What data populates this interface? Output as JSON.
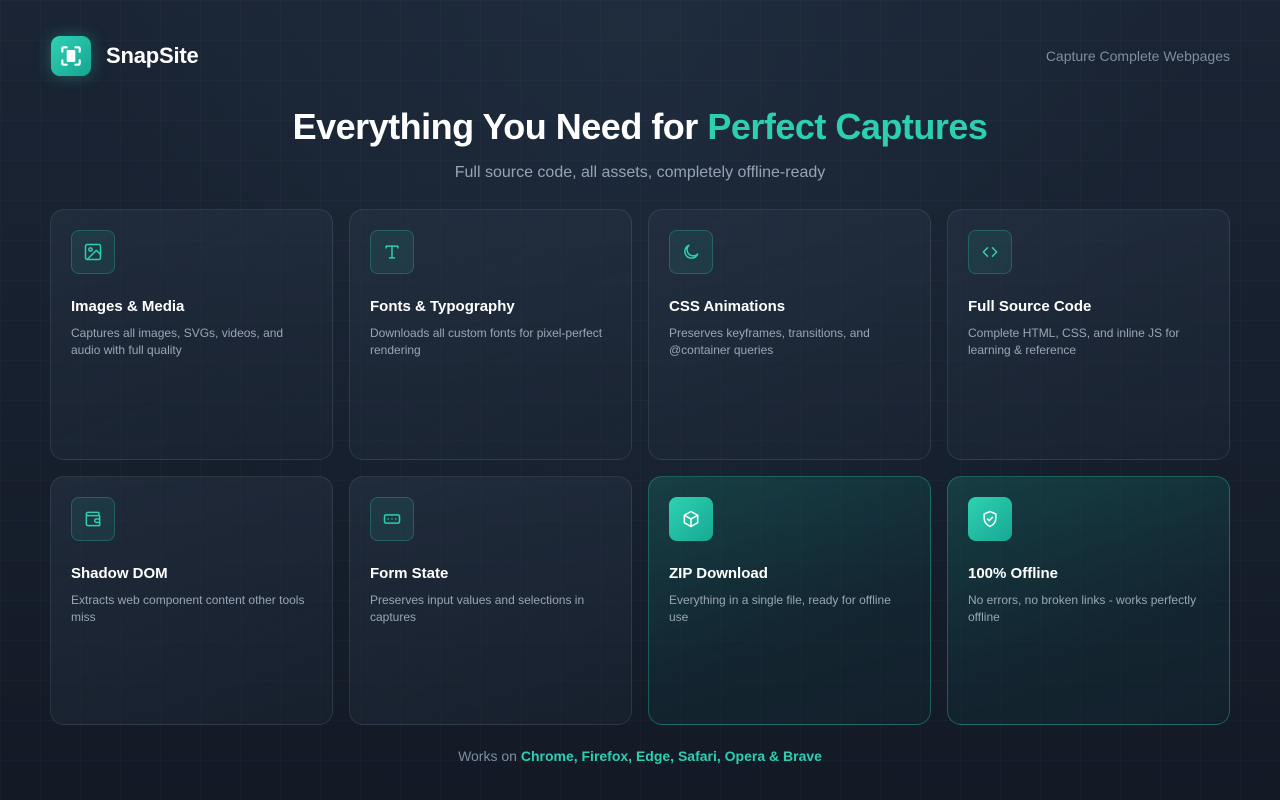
{
  "brand": {
    "name": "SnapSite",
    "tagline": "Capture Complete Webpages"
  },
  "hero": {
    "title_main": "Everything You Need for ",
    "title_accent": "Perfect Captures",
    "subtitle": "Full source code, all assets, completely offline-ready"
  },
  "features": [
    {
      "title": "Images & Media",
      "description": "Captures all images, SVGs, videos, and audio with full quality",
      "icon": "image-icon"
    },
    {
      "title": "Fonts & Typography",
      "description": "Downloads all custom fonts for pixel-perfect rendering",
      "icon": "type-icon"
    },
    {
      "title": "CSS Animations",
      "description": "Preserves keyframes, transitions, and @container queries",
      "icon": "moon-icon"
    },
    {
      "title": "Full Source Code",
      "description": "Complete HTML, CSS, and inline JS for learning & reference",
      "icon": "code-icon"
    },
    {
      "title": "Shadow DOM",
      "description": "Extracts web component content other tools miss",
      "icon": "wallet-icon"
    },
    {
      "title": "Form State",
      "description": "Preserves input values and selections in captures",
      "icon": "input-icon"
    },
    {
      "title": "ZIP Download",
      "description": "Everything in a single file, ready for offline use",
      "icon": "package-icon"
    },
    {
      "title": "100% Offline",
      "description": "No errors, no broken links - works perfectly offline",
      "icon": "shield-check-icon"
    }
  ],
  "footer": {
    "prefix": "Works on ",
    "browsers": "Chrome, Firefox, Edge, Safari, Opera & Brave"
  },
  "colors": {
    "accent": "#2ccfb1",
    "background": "#161f2d"
  }
}
